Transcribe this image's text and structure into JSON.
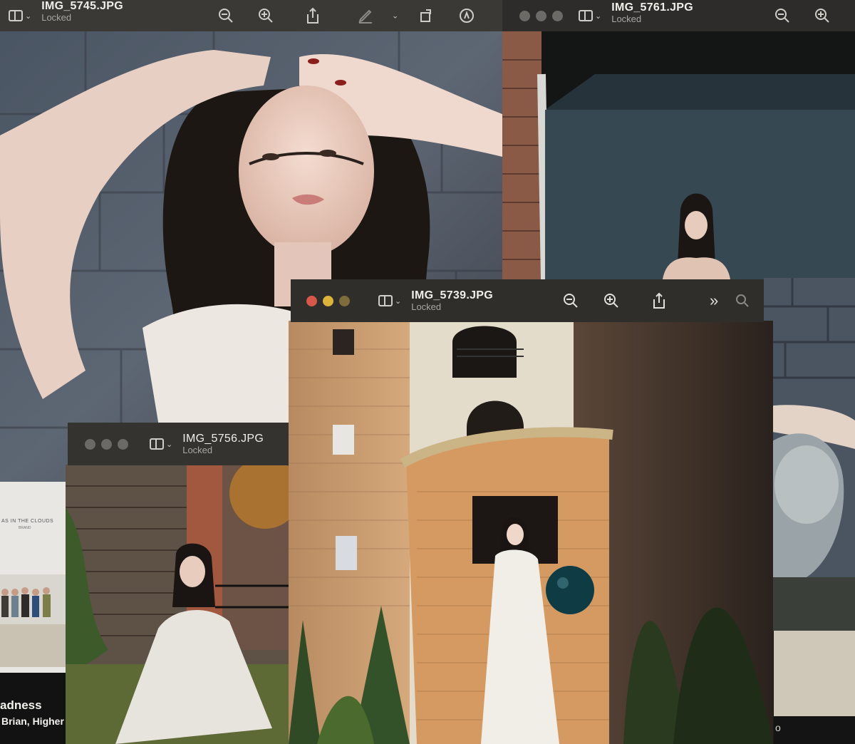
{
  "windows": {
    "top_left": {
      "filename": "IMG_5745.JPG",
      "state": "Locked"
    },
    "top_right": {
      "filename": "IMG_5761.JPG",
      "state": "Locked"
    },
    "center": {
      "filename": "IMG_5739.JPG",
      "state": "Locked"
    },
    "bottom_left": {
      "filename": "IMG_5756.JPG",
      "state": "Locked"
    }
  },
  "background_card": {
    "poster_text": "AS IN THE CLOUDS",
    "poster_subtext": "BRAND",
    "track_title": "adness",
    "track_artist": "Brian, Higher"
  },
  "right_card_fragment": "o",
  "colors": {
    "titlebar": "#2b2a28",
    "close": "#d6584b",
    "minimize": "#dcb43c",
    "zoom": "#7e6c3d",
    "inactive_dot": "#6b6a67"
  },
  "icons": [
    "sidebar-toggle-icon",
    "chevron-down-icon",
    "zoom-out-icon",
    "zoom-in-icon",
    "share-icon",
    "markup-pen-icon",
    "rotate-icon",
    "markup-icon",
    "more-icon",
    "search-icon"
  ]
}
